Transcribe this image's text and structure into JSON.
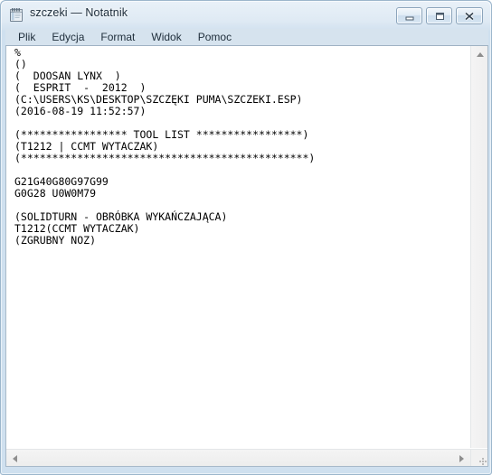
{
  "window": {
    "title": "szczeki — Notatnik",
    "icon": "notepad-icon"
  },
  "titlebar_buttons": {
    "minimize_label": "─",
    "maximize_label": "□",
    "close_label": "✕"
  },
  "menubar": {
    "items": [
      {
        "label": "Plik"
      },
      {
        "label": "Edycja"
      },
      {
        "label": "Format"
      },
      {
        "label": "Widok"
      },
      {
        "label": "Pomoc"
      }
    ]
  },
  "editor": {
    "text": "%\n()\n(  DOOSAN LYNX  )\n(  ESPRIT  -  2012  )\n(C:\\USERS\\KS\\DESKTOP\\SZCZĘKI PUMA\\SZCZEKI.ESP)\n(2016-08-19 11:52:57)\n\n(***************** TOOL LIST *****************)\n(T1212 | CCMT WYTACZAK)\n(**********************************************)\n\nG21G40G80G97G99\nG0G28 U0W0M79\n\n(SOLIDTURN - OBRÓBKA WYKAŃCZAJĄCA)\nT1212(CCMT WYTACZAK)\n(ZGRUBNY NOZ)"
  },
  "scrollbars": {
    "vertical_up_arrow": "scroll-up-arrow",
    "horizontal_left_arrow": "scroll-left-arrow",
    "horizontal_right_arrow": "scroll-right-arrow",
    "resize_grip": "resize-grip"
  }
}
